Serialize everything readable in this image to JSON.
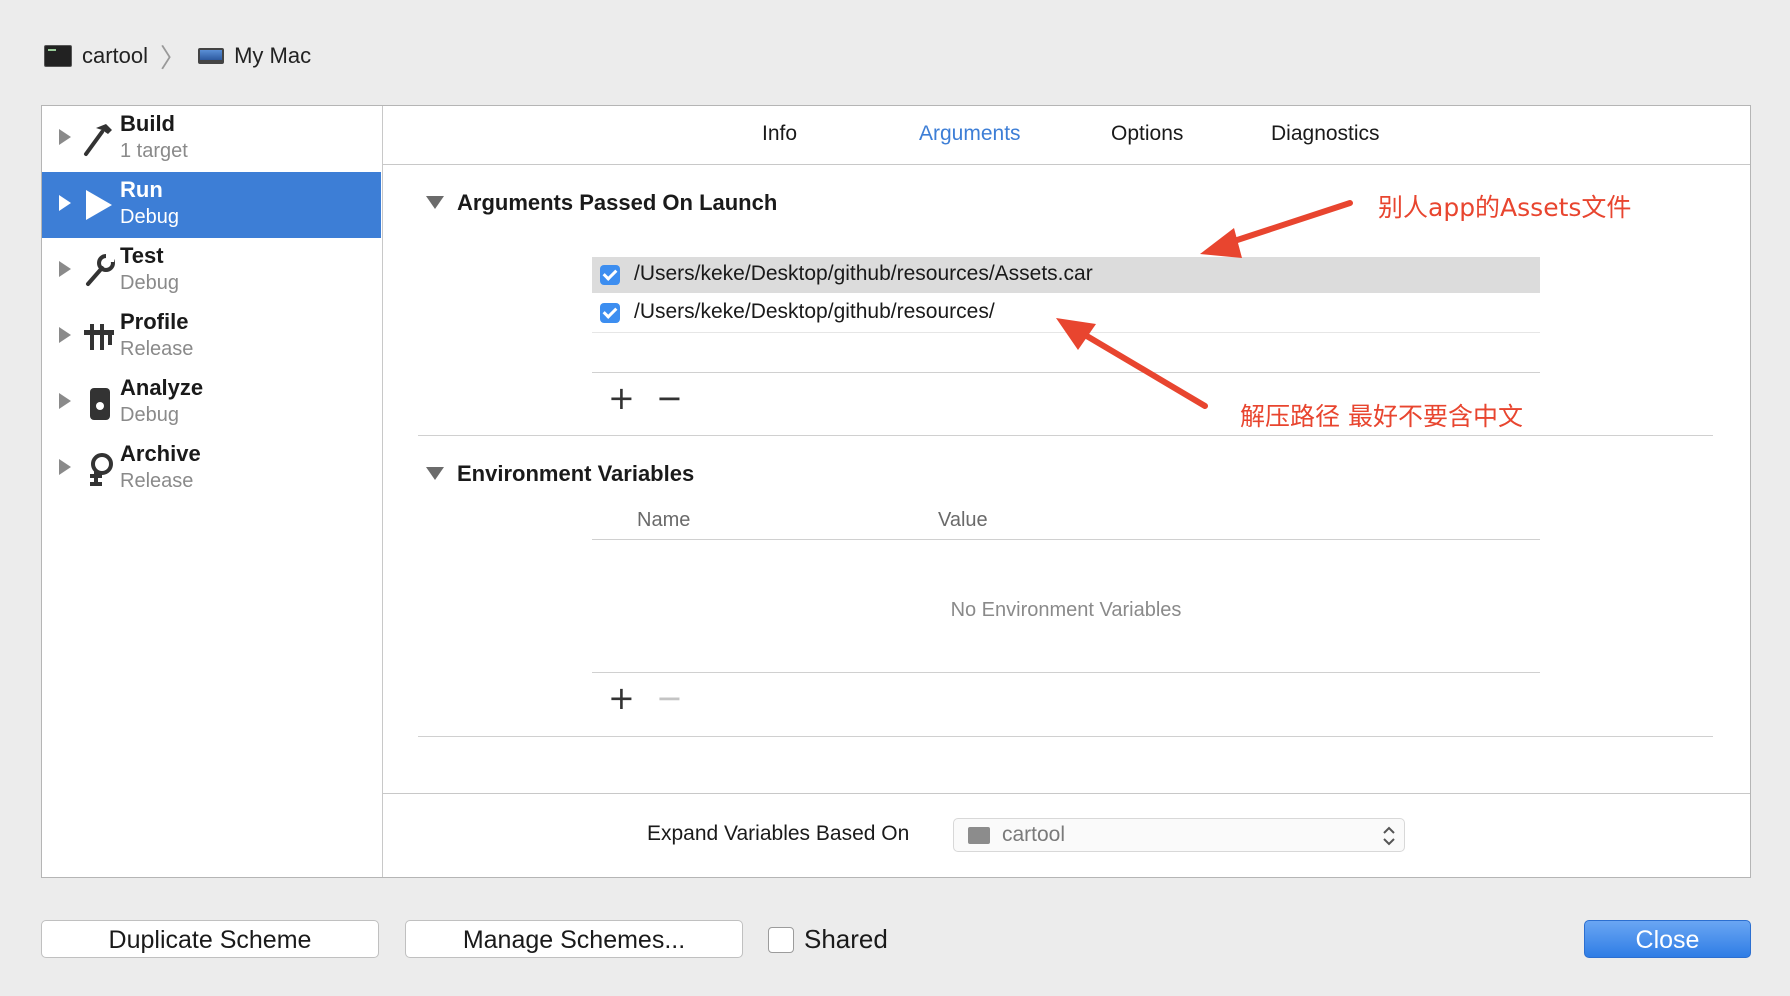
{
  "breadcrumb": {
    "scheme": "cartool",
    "destination": "My Mac"
  },
  "sidebar": {
    "items": [
      {
        "title": "Build",
        "subtitle": "1 target",
        "icon": "hammer-icon"
      },
      {
        "title": "Run",
        "subtitle": "Debug",
        "icon": "play-icon",
        "selected": true
      },
      {
        "title": "Test",
        "subtitle": "Debug",
        "icon": "wrench-icon"
      },
      {
        "title": "Profile",
        "subtitle": "Release",
        "icon": "instruments-icon"
      },
      {
        "title": "Analyze",
        "subtitle": "Debug",
        "icon": "analyze-icon"
      },
      {
        "title": "Archive",
        "subtitle": "Release",
        "icon": "archive-icon"
      }
    ]
  },
  "tabs": [
    {
      "label": "Info"
    },
    {
      "label": "Arguments",
      "active": true
    },
    {
      "label": "Options"
    },
    {
      "label": "Diagnostics"
    }
  ],
  "arguments_section": {
    "title": "Arguments Passed On Launch",
    "rows": [
      {
        "value": "/Users/keke/Desktop/github/resources/Assets.car",
        "checked": true
      },
      {
        "value": "/Users/keke/Desktop/github/resources/",
        "checked": true
      }
    ]
  },
  "env_section": {
    "title": "Environment Variables",
    "col_name": "Name",
    "col_value": "Value",
    "empty_text": "No Environment Variables"
  },
  "expand": {
    "label": "Expand Variables Based On",
    "value": "cartool"
  },
  "annotations": {
    "note1": "别人app的Assets文件",
    "note2": "解压路径 最好不要含中文",
    "color": "#e8452f"
  },
  "buttons": {
    "duplicate": "Duplicate Scheme",
    "manage": "Manage Schemes...",
    "shared_label": "Shared",
    "close": "Close"
  },
  "colors": {
    "accent": "#3d7ed6",
    "selected_row": "#3d7ed6"
  }
}
